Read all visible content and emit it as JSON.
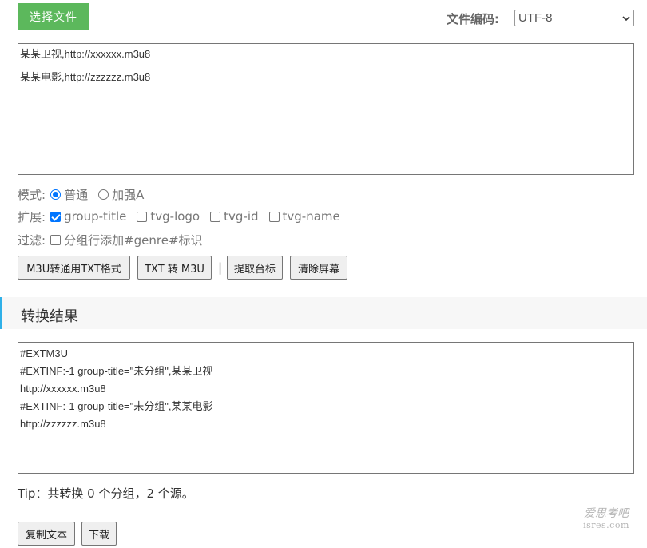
{
  "top": {
    "choose_file_label": "选择文件",
    "encoding_label": "文件编码:",
    "encoding_value": "UTF-8"
  },
  "input": {
    "lines": [
      "某某卫视,http://xxxxxx.m3u8",
      "某某电影,http://zzzzzz.m3u8"
    ]
  },
  "mode": {
    "label": "模式:",
    "options": [
      {
        "label": "普通",
        "selected": true
      },
      {
        "label": "加强A",
        "selected": false
      }
    ]
  },
  "extend": {
    "label": "扩展:",
    "options": [
      {
        "label": "group-title",
        "checked": true
      },
      {
        "label": "tvg-logo",
        "checked": false
      },
      {
        "label": "tvg-id",
        "checked": false
      },
      {
        "label": "tvg-name",
        "checked": false
      }
    ]
  },
  "filter": {
    "label": "过滤:",
    "options": [
      {
        "label": "分组行添加#genre#标识",
        "checked": false
      }
    ]
  },
  "actions": {
    "m3u_to_txt": "M3U转通用TXT格式",
    "txt_to_m3u": "TXT 转 M3U",
    "separator": "|",
    "extract_logo": "提取台标",
    "clear_screen": "清除屏幕"
  },
  "result": {
    "title": "转换结果",
    "lines": [
      "#EXTM3U",
      "#EXTINF:-1 group-title=\"未分组\",某某卫视",
      "http://xxxxxx.m3u8",
      "#EXTINF:-1 group-title=\"未分组\",某某电影",
      "http://zzzzzz.m3u8"
    ]
  },
  "tip": "Tip：共转换 0 个分组，2 个源。",
  "bottom": {
    "copy_label": "复制文本",
    "download_label": "下载"
  },
  "watermark": {
    "line1": "爱思考吧",
    "line2": "isres.com"
  },
  "colors": {
    "primary_green": "#5cb85c",
    "accent_blue": "#2fb0e8",
    "control_blue": "#0075ff"
  }
}
